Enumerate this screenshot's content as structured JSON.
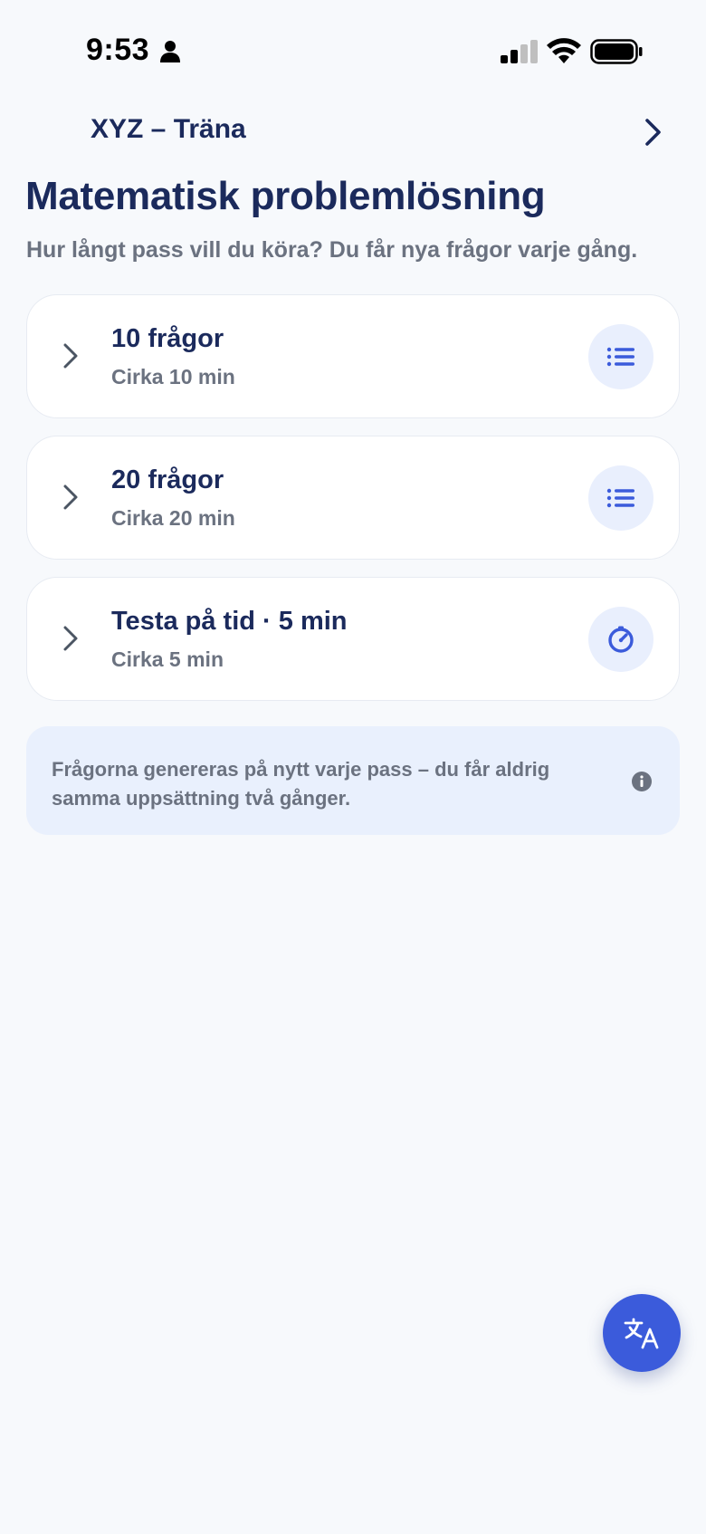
{
  "status_bar": {
    "time": "9:53",
    "icons": [
      "person-icon",
      "cellular-signal-icon",
      "wifi-icon",
      "battery-icon"
    ]
  },
  "header": {
    "breadcrumb": "XYZ – Träna",
    "forward_icon": "chevron-right-icon",
    "title": "Matematisk problemlösning",
    "subtitle": "Hur långt pass vill du köra? Du får nya frågor varje gång."
  },
  "options": [
    {
      "title": "10 frågor",
      "subtitle": "Cirka 10 min",
      "icon": "list-icon"
    },
    {
      "title": "20 frågor",
      "subtitle": "Cirka 20 min",
      "icon": "list-icon"
    },
    {
      "title": "Testa på tid · 5 min",
      "subtitle": "Cirka 5 min",
      "icon": "timer-icon"
    }
  ],
  "info": {
    "text": "Frågorna genereras på nytt varje pass – du får aldrig samma uppsättning två gånger.",
    "icon": "info-icon"
  },
  "fab": {
    "icon": "translate-icon"
  },
  "colors": {
    "background": "#f7f9fc",
    "title": "#1b2a5c",
    "muted_text": "#6b7280",
    "accent": "#3b5bdb",
    "icon_bubble": "#e9effd",
    "info_background": "#e9f0fd"
  }
}
